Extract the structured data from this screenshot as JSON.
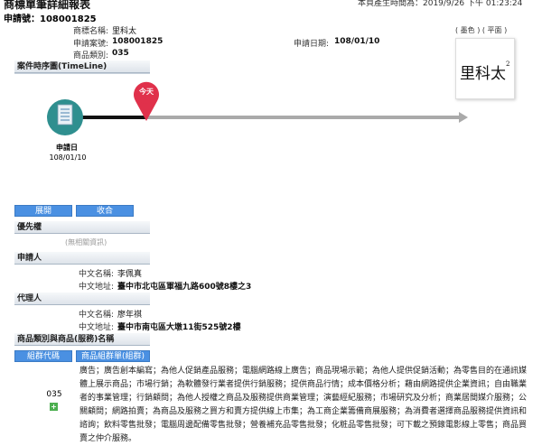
{
  "header": {
    "title": "商標單筆詳細報表",
    "generated": "本頁產生時間為：2019/9/26 下午 01:23:24",
    "app_no_label": "申請號：",
    "app_no": "108001825"
  },
  "mark_info": {
    "name_label": "商標名稱:",
    "name": "里科太",
    "case_label": "申請案號:",
    "case": "108001825",
    "class_label": "商品類別:",
    "class_value": "035",
    "date_label": "申請日期:",
    "date": "108/01/10"
  },
  "mark_image": {
    "tags": "( 墨色 ) ( 平面 )",
    "text": "里科太",
    "sup": "2"
  },
  "timeline": {
    "section_label": "案件時序圖(TimeLine)",
    "today_label": "今天",
    "event_label": "申請日",
    "event_date": "108/01/10",
    "accent": "#e0314b"
  },
  "buttons": {
    "expand": "展開",
    "collapse": "收合"
  },
  "priority": {
    "label": "優先權",
    "empty": "(無相關資訊)"
  },
  "applicant": {
    "label": "申請人",
    "name_label": "中文名稱:",
    "name": "李佩真",
    "addr_label": "中文地址:",
    "addr": "臺中市北屯區軍福九路600號8樓之3"
  },
  "agent": {
    "label": "代理人",
    "name_label": "中文名稱:",
    "name": "廖年祺",
    "addr_label": "中文地址:",
    "addr": "臺中市南屯區大墩11街525號2樓"
  },
  "goods": {
    "label": "商品類別與商品(服務)名稱",
    "group_code_btn": "組群代碼",
    "group_list_btn": "商品組群單(組群)",
    "class_no": "035",
    "description": "廣告；廣告創本編寫；為他人促銷產品服務；電腦網路線上廣告；商品現場示範；為他人提供促銷活動；為零售目的在通訊媒體上展示商品；市場行銷；為軟體發行業者提供行銷服務；提供商品行情；成本價格分析；藉由網路提供企業資訊；自由職業者的事業管理；行銷顧問；為他人授權之商品及服務提供商業管理；演藝經紀服務；市場研究及分析；商業居間媒介服務；公關顧問；網路拍賣；為商品及服務之買方和賣方提供線上市集；為工商企業籌備商展服務；為消費者選擇商品服務提供資訊和諮詢；飲料零售批發；電腦周邊配備零售批發；營養補充品零售批發；化粧品零售批發；可下載之預錄電影線上零售；商品買賣之仲介服務。"
  }
}
